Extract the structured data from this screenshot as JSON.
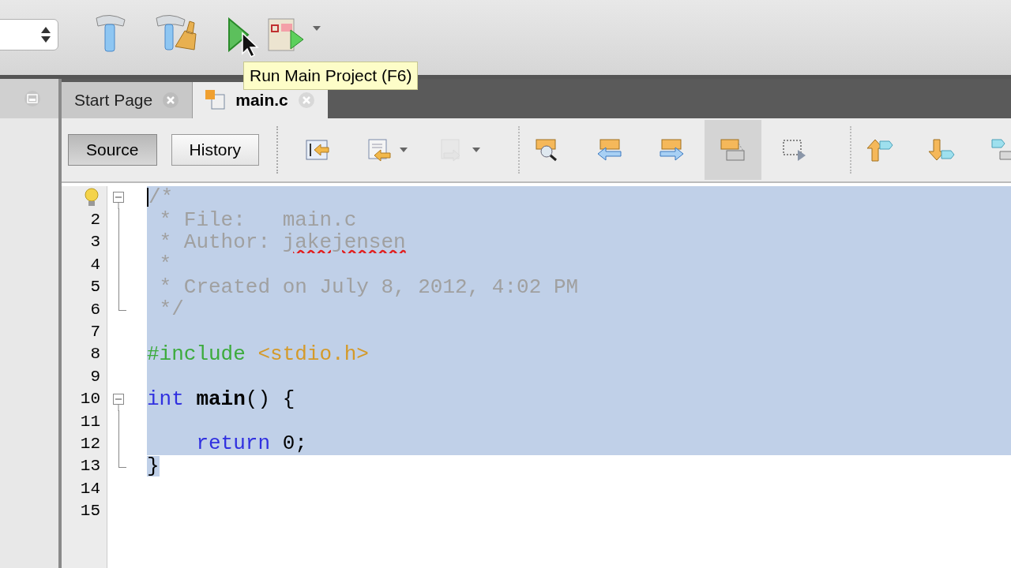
{
  "tooltip": {
    "text": "Run Main Project (F6)"
  },
  "editor_tabs": [
    {
      "label": "Start Page",
      "selected": false
    },
    {
      "label": "main.c",
      "selected": true
    }
  ],
  "view_buttons": [
    {
      "label": "Source",
      "selected": true
    },
    {
      "label": "History",
      "selected": false
    }
  ],
  "editor_toolbar": [
    {
      "kind": "last-edit",
      "disabled": false,
      "pressed": false
    },
    {
      "kind": "prev-bookmark",
      "disabled": false,
      "pressed": false,
      "dropdown": true
    },
    {
      "kind": "next-bookmark",
      "disabled": true,
      "pressed": false,
      "dropdown": true
    },
    {
      "kind": "separator"
    },
    {
      "kind": "find",
      "disabled": false,
      "pressed": false
    },
    {
      "kind": "find-prev",
      "disabled": false,
      "pressed": false
    },
    {
      "kind": "find-next",
      "disabled": false,
      "pressed": false
    },
    {
      "kind": "highlight",
      "disabled": false,
      "pressed": true
    },
    {
      "kind": "rect-select",
      "disabled": false,
      "pressed": false
    },
    {
      "kind": "separator"
    },
    {
      "kind": "shift-up",
      "disabled": false,
      "pressed": false
    },
    {
      "kind": "shift-down",
      "disabled": false,
      "pressed": false
    },
    {
      "kind": "macro",
      "disabled": false,
      "pressed": false
    }
  ],
  "code_lines": [
    {
      "kind": "fold-start",
      "hint": true,
      "selected": true,
      "tokens": [
        {
          "kind": "comment",
          "text": "/*"
        }
      ]
    },
    {
      "number": "2",
      "kind": "fold-body",
      "selected": true,
      "tokens": [
        {
          "kind": "comment",
          "text": " * File:   main.c"
        }
      ]
    },
    {
      "number": "3",
      "kind": "fold-body",
      "selected": true,
      "tokens": [
        {
          "kind": "comment",
          "text": " * Author: "
        },
        {
          "kind": "misspelled",
          "text": "jakejensen"
        }
      ]
    },
    {
      "number": "4",
      "kind": "fold-body",
      "selected": true,
      "tokens": [
        {
          "kind": "comment",
          "text": " *"
        }
      ]
    },
    {
      "number": "5",
      "kind": "fold-body",
      "selected": true,
      "tokens": [
        {
          "kind": "comment",
          "text": " * Created on July 8, 2012, 4:02 PM"
        }
      ]
    },
    {
      "number": "6",
      "kind": "fold-end",
      "selected": true,
      "tokens": [
        {
          "kind": "comment",
          "text": " */"
        }
      ]
    },
    {
      "number": "7",
      "kind": "plain",
      "selected": true
    },
    {
      "number": "8",
      "kind": "plain",
      "selected": true,
      "tokens": [
        {
          "kind": "preproc",
          "text": "#include"
        },
        {
          "kind": "header",
          "text": " <stdio.h>"
        }
      ]
    },
    {
      "number": "9",
      "kind": "plain",
      "selected": true
    },
    {
      "number": "10",
      "kind": "fold-start",
      "selected": true,
      "tokens": [
        {
          "kind": "keyword",
          "text": "int"
        },
        {
          "kind": "function",
          "text": " main"
        },
        {
          "kind": "plain",
          "text": "() {"
        }
      ]
    },
    {
      "number": "11",
      "kind": "fold-body",
      "selected": true
    },
    {
      "number": "12",
      "kind": "fold-body",
      "selected": true,
      "tokens": [
        {
          "kind": "keyword",
          "text": "    return"
        },
        {
          "kind": "plain",
          "text": " 0;"
        }
      ]
    },
    {
      "number": "13",
      "kind": "fold-end",
      "selected": false,
      "tokens": [
        {
          "kind": "plain",
          "text": "}",
          "selected": true
        }
      ]
    },
    {
      "number": "14",
      "kind": "plain",
      "selected": false
    },
    {
      "number": "15",
      "kind": "plain",
      "selected": false
    }
  ]
}
